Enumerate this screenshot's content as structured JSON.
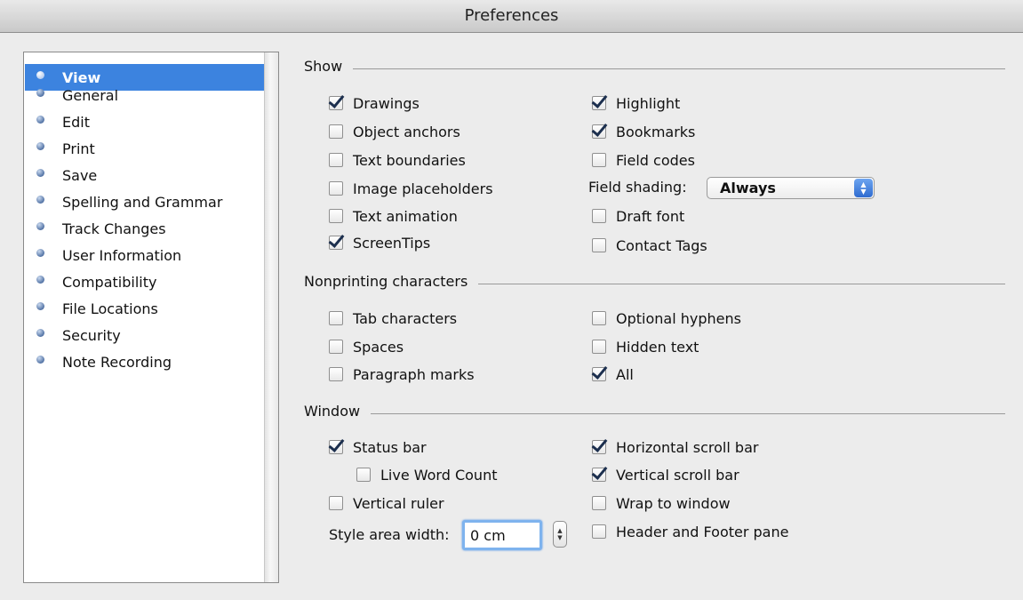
{
  "window": {
    "title": "Preferences"
  },
  "sidebar": {
    "items": [
      {
        "label": "View",
        "selected": true
      },
      {
        "label": "General"
      },
      {
        "label": "Edit"
      },
      {
        "label": "Print"
      },
      {
        "label": "Save"
      },
      {
        "label": "Spelling and Grammar"
      },
      {
        "label": "Track Changes"
      },
      {
        "label": "User Information"
      },
      {
        "label": "Compatibility"
      },
      {
        "label": "File Locations"
      },
      {
        "label": "Security"
      },
      {
        "label": "Note Recording"
      }
    ]
  },
  "show": {
    "heading": "Show",
    "drawings": {
      "label": "Drawings",
      "checked": true
    },
    "object_anchors": {
      "label": "Object anchors",
      "checked": false
    },
    "text_boundaries": {
      "label": "Text boundaries",
      "checked": false
    },
    "image_placeholders": {
      "label": "Image placeholders",
      "checked": false
    },
    "text_animation": {
      "label": "Text animation",
      "checked": false
    },
    "screentips": {
      "label": "ScreenTips",
      "checked": true
    },
    "highlight": {
      "label": "Highlight",
      "checked": true
    },
    "bookmarks": {
      "label": "Bookmarks",
      "checked": true
    },
    "field_codes": {
      "label": "Field codes",
      "checked": false
    },
    "field_shading_label": "Field shading:",
    "field_shading_value": "Always",
    "draft_font": {
      "label": "Draft font",
      "checked": false
    },
    "contact_tags": {
      "label": "Contact Tags",
      "checked": false
    }
  },
  "nonprinting": {
    "heading": "Nonprinting characters",
    "tab_characters": {
      "label": "Tab characters",
      "checked": false
    },
    "spaces": {
      "label": "Spaces",
      "checked": false
    },
    "paragraph_marks": {
      "label": "Paragraph marks",
      "checked": false
    },
    "optional_hyphens": {
      "label": "Optional hyphens",
      "checked": false
    },
    "hidden_text": {
      "label": "Hidden text",
      "checked": false
    },
    "all": {
      "label": "All",
      "checked": true
    }
  },
  "window_section": {
    "heading": "Window",
    "status_bar": {
      "label": "Status bar",
      "checked": true
    },
    "live_word_count": {
      "label": "Live Word Count",
      "checked": false
    },
    "vertical_ruler": {
      "label": "Vertical ruler",
      "checked": false
    },
    "style_area_label": "Style area width:",
    "style_area_value": "0 cm",
    "horizontal_scroll_bar": {
      "label": "Horizontal scroll bar",
      "checked": true
    },
    "vertical_scroll_bar": {
      "label": "Vertical scroll bar",
      "checked": true
    },
    "wrap_to_window": {
      "label": "Wrap to window",
      "checked": false
    },
    "header_footer_pane": {
      "label": "Header and Footer pane",
      "checked": false
    }
  }
}
